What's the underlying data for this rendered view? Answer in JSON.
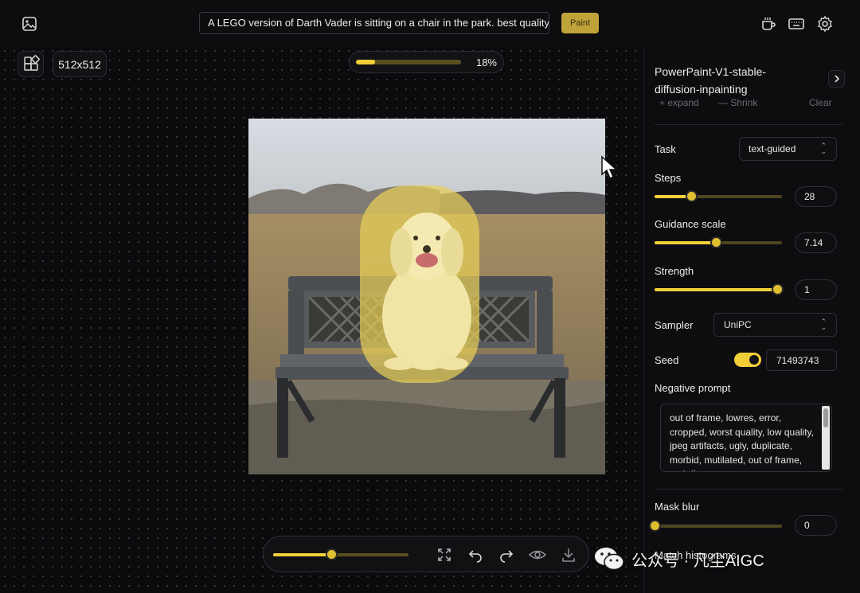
{
  "topbar": {
    "prompt_value": "A LEGO version of Darth Vader is sitting on a chair in the park. best quality",
    "paint_label": "Paint",
    "icons": [
      "image-icon",
      "coffee-icon",
      "keyboard-icon",
      "settings-icon"
    ]
  },
  "canvas": {
    "size_label": "512x512",
    "progress_text": "18%",
    "progress_fraction": 0.18,
    "brush_size_fraction": 0.43
  },
  "panel": {
    "model_name": "PowerPaint-V1-stable-diffusion-inpainting",
    "partial_buttons": [
      "+ expand",
      "— Shrink",
      "Clear"
    ],
    "task": {
      "label": "Task",
      "value": "text-guided"
    },
    "steps": {
      "label": "Steps",
      "value": "28",
      "fraction": 0.29
    },
    "guidance": {
      "label": "Guidance scale",
      "value": "7.14",
      "fraction": 0.48
    },
    "strength": {
      "label": "Strength",
      "value": "1",
      "fraction": 0.96
    },
    "sampler": {
      "label": "Sampler",
      "value": "UniPC"
    },
    "seed": {
      "label": "Seed",
      "value": "71493743",
      "enabled": true
    },
    "negative_prompt": {
      "label": "Negative prompt",
      "value": "out of frame, lowres, error, cropped, worst quality, low quality, jpeg artifacts, ugly, duplicate, morbid, mutilated, out of frame, mutation"
    },
    "mask_blur": {
      "label": "Mask blur",
      "value": "0",
      "fraction": 0.0
    },
    "match_histograms": {
      "label": "Match histograms"
    }
  },
  "watermark": {
    "text": "公众号 · 凡尘AIGC"
  },
  "colors": {
    "accent": "#f2cf39",
    "background": "#0b0b0d"
  }
}
